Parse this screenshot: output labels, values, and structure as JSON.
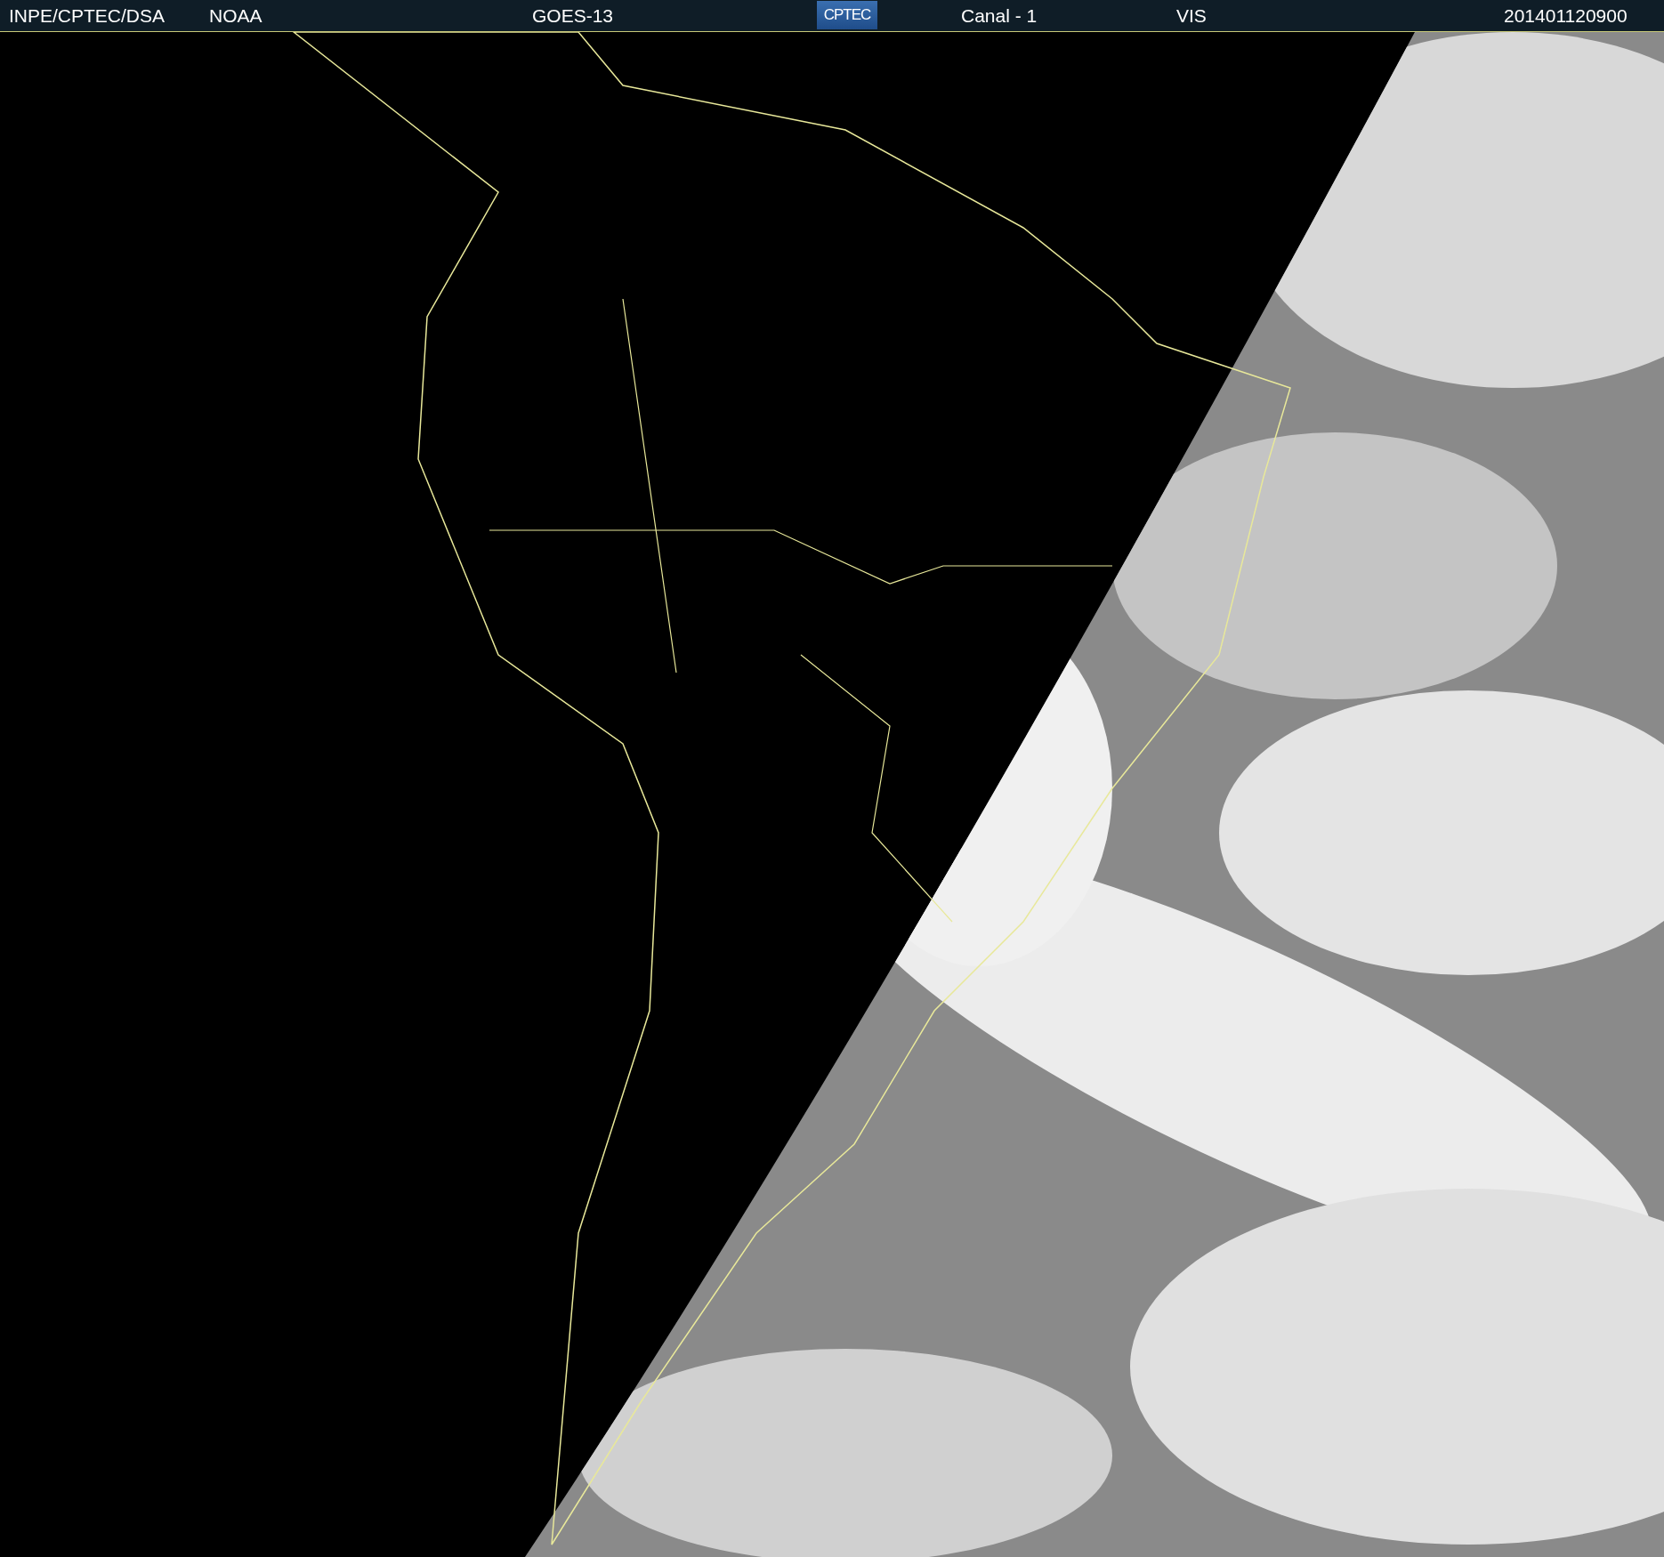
{
  "header": {
    "items": [
      {
        "kind": "text",
        "text": "INPE/CPTEC/DSA"
      },
      {
        "kind": "text",
        "text": "NOAA"
      },
      {
        "kind": "text",
        "text": "GOES-13"
      },
      {
        "kind": "logo",
        "text": "CPTEC"
      },
      {
        "kind": "text",
        "text": "Canal - 1"
      },
      {
        "kind": "text",
        "text": "VIS"
      },
      {
        "kind": "text",
        "text": "201401120900"
      }
    ]
  }
}
